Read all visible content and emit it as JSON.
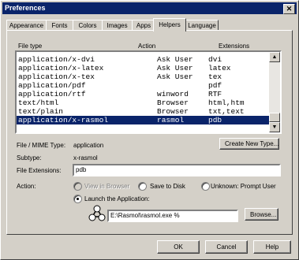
{
  "window": {
    "title": "Preferences",
    "close_glyph": "✕"
  },
  "tabs": [
    {
      "label": "Appearance"
    },
    {
      "label": "Fonts"
    },
    {
      "label": "Colors"
    },
    {
      "label": "Images"
    },
    {
      "label": "Apps"
    },
    {
      "label": "Helpers"
    },
    {
      "label": "Language"
    }
  ],
  "list": {
    "headers": {
      "file_type": "File type",
      "action": "Action",
      "extensions": "Extensions"
    },
    "rows": [
      {
        "type": "application/x-dvi",
        "action": "Ask User",
        "ext": "dvi"
      },
      {
        "type": "application/x-latex",
        "action": "Ask User",
        "ext": "latex"
      },
      {
        "type": "application/x-tex",
        "action": "Ask User",
        "ext": "tex"
      },
      {
        "type": "application/pdf",
        "action": "",
        "ext": "pdf"
      },
      {
        "type": "application/rtf",
        "action": "winword",
        "ext": "RTF"
      },
      {
        "type": "text/html",
        "action": "Browser",
        "ext": "html,htm"
      },
      {
        "type": "text/plain",
        "action": "Browser",
        "ext": "txt,text"
      },
      {
        "type": "application/x-rasmol",
        "action": "rasmol",
        "ext": "pdb"
      }
    ],
    "selected_index": 7
  },
  "details": {
    "mime_label": "File / MIME Type:",
    "mime_value": "application",
    "subtype_label": "Subtype:",
    "subtype_value": "x-rasmol",
    "extensions_label": "File Extensions:",
    "extensions_value": "pdb",
    "action_label": "Action:",
    "create_button": "Create New Type...",
    "view_in_browser": "View in Browser",
    "save_to_disk": "Save to Disk",
    "unknown_prompt": "Unknown: Prompt User",
    "launch_app": "Launch the Application:",
    "app_path": "E:\\Rasmol\\rasmol.exe %",
    "browse_button": "Browse..."
  },
  "footer": {
    "ok": "OK",
    "cancel": "Cancel",
    "help": "Help"
  }
}
